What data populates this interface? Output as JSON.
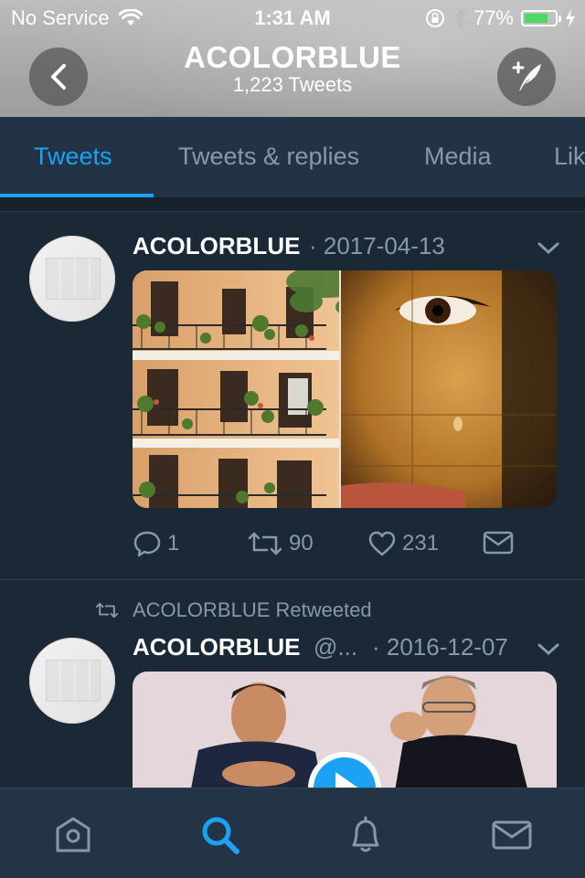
{
  "status_bar": {
    "carrier": "No Service",
    "time": "1:31 AM",
    "battery": "77%",
    "battery_level": 0.77
  },
  "header": {
    "title": "ACOLORBLUE",
    "subtitle": "1,223 Tweets"
  },
  "tabs": [
    {
      "label": "Tweets",
      "active": true
    },
    {
      "label": "Tweets & replies",
      "active": false
    },
    {
      "label": "Media",
      "active": false
    },
    {
      "label": "Likes",
      "active": false
    }
  ],
  "tweets": [
    {
      "name": "ACOLORBLUE",
      "date": "· 2017-04-13",
      "replies": "1",
      "retweets": "90",
      "likes": "231"
    },
    {
      "retweet_label": "ACOLORBLUE Retweeted",
      "name": "ACOLORBLUE",
      "handle": "@...",
      "date": "· 2016-12-07"
    }
  ],
  "colors": {
    "accent": "#1da1f2",
    "background": "#1b2836",
    "muted": "#8899a6"
  }
}
